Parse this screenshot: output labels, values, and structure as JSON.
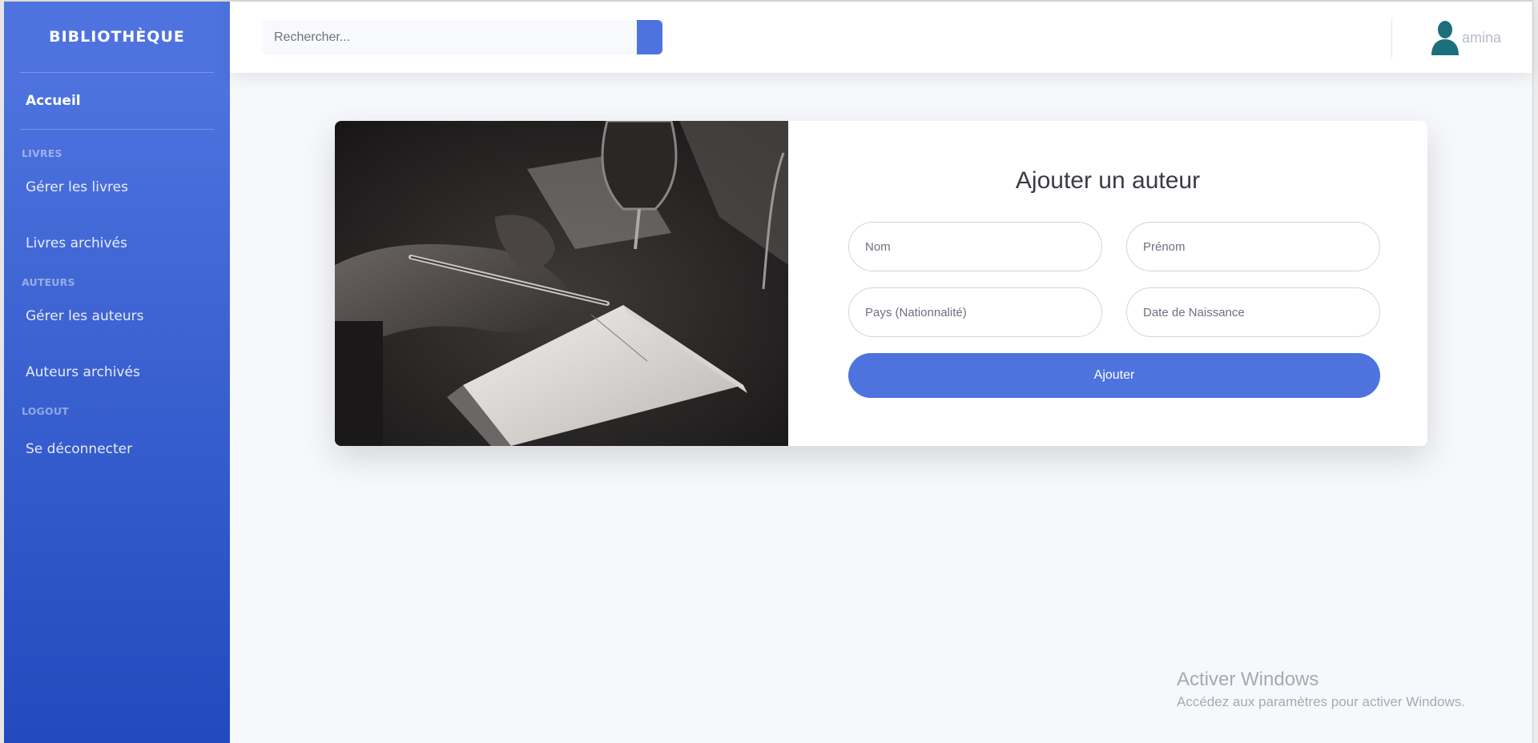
{
  "sidebar": {
    "brand": "BIBLIOTHÈQUE",
    "home": "Accueil",
    "sections": {
      "livres": {
        "heading": "LIVRES",
        "items": [
          "Gérer les livres",
          "Livres archivés"
        ]
      },
      "auteurs": {
        "heading": "AUTEURS",
        "items": [
          "Gérer les auteurs",
          "Auteurs archivés"
        ]
      },
      "logout": {
        "heading": "LOGOUT",
        "items": [
          "Se déconnecter"
        ]
      }
    }
  },
  "topbar": {
    "search_placeholder": "Rechercher...",
    "user_name": "amina"
  },
  "form": {
    "title": "Ajouter un auteur",
    "fields": {
      "nom": "Nom",
      "prenom": "Prénom",
      "pays": "Pays (Nationnalité)",
      "date": "Date de Naissance"
    },
    "submit": "Ajouter"
  },
  "watermark": {
    "title": "Activer Windows",
    "subtitle": "Accédez aux paramètres pour activer Windows."
  },
  "colors": {
    "primary": "#4e73df",
    "sidebar_gradient_end": "#224abe",
    "user_icon": "#1b6e7a"
  }
}
